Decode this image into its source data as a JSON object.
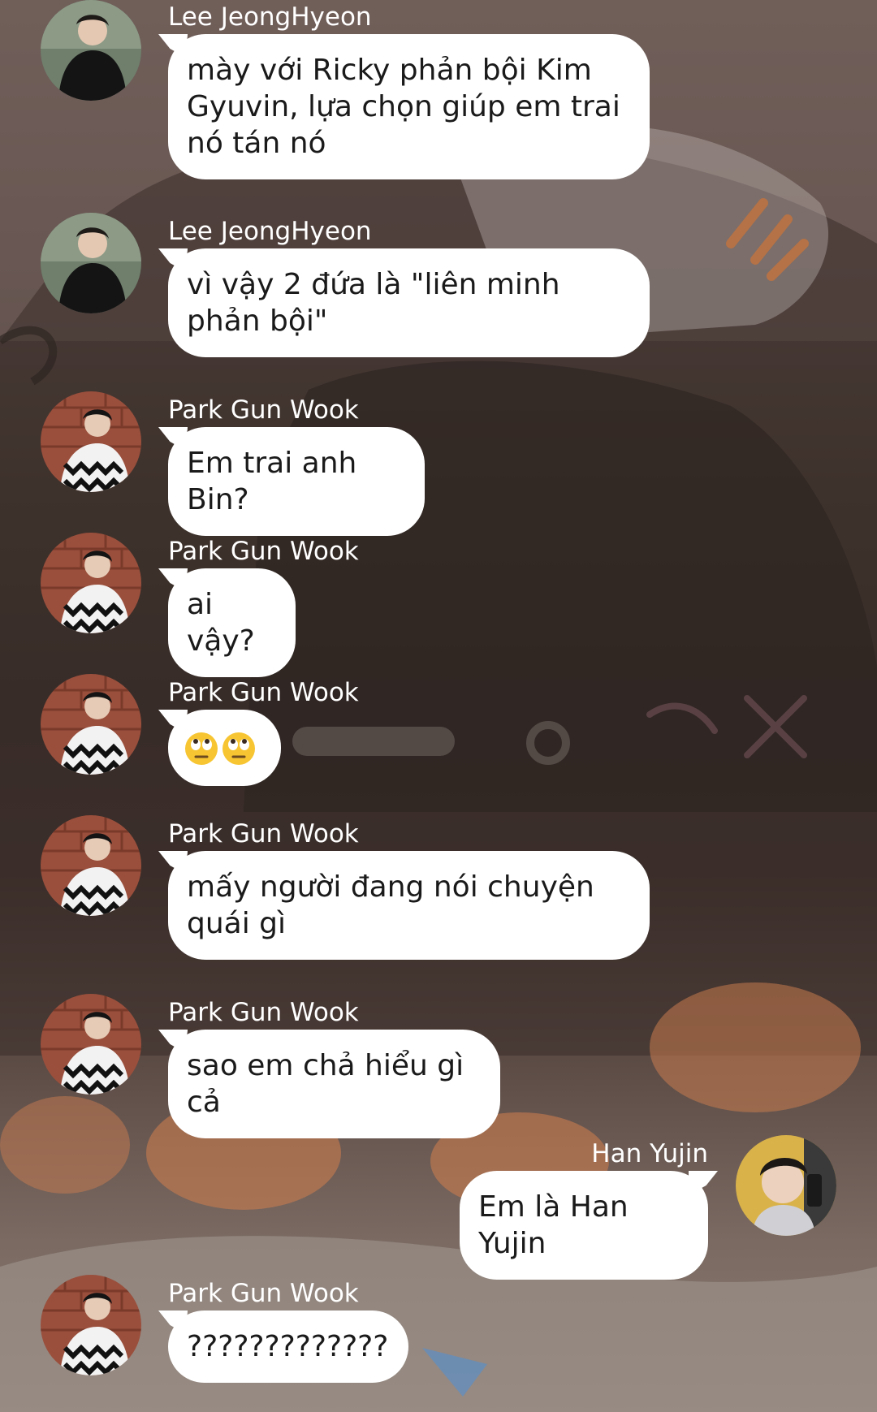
{
  "chat": {
    "messages": [
      {
        "sender": "Lee JeongHyeon",
        "text": "mày với Ricky phản bội Kim Gyuvin, lựa chọn giúp em trai nó tán nó",
        "direction": "incoming",
        "avatar": "avatar-lee-jeonghyeon"
      },
      {
        "sender": "Lee JeongHyeon",
        "text": "vì vậy 2 đứa là \"liên minh phản bội\"",
        "direction": "incoming",
        "avatar": "avatar-lee-jeonghyeon"
      },
      {
        "sender": "Park Gun Wook",
        "text": "Em trai anh Bin?",
        "direction": "incoming",
        "avatar": "avatar-park-gun-wook"
      },
      {
        "sender": "Park Gun Wook",
        "text": "ai vậy?",
        "direction": "incoming",
        "avatar": "avatar-park-gun-wook"
      },
      {
        "sender": "Park Gun Wook",
        "text": "",
        "emojis": [
          "eye-roll-emoji",
          "eye-roll-emoji"
        ],
        "direction": "incoming",
        "avatar": "avatar-park-gun-wook"
      },
      {
        "sender": "Park Gun Wook",
        "text": "mấy người đang nói chuyện quái gì",
        "direction": "incoming",
        "avatar": "avatar-park-gun-wook"
      },
      {
        "sender": "Park Gun Wook",
        "text": "sao em chả hiểu gì cả",
        "direction": "incoming",
        "avatar": "avatar-park-gun-wook"
      },
      {
        "sender": "Han Yujin",
        "text": "Em là Han Yujin",
        "direction": "outgoing",
        "avatar": "avatar-han-yujin"
      },
      {
        "sender": "Park Gun Wook",
        "text": "?????????????",
        "direction": "incoming",
        "avatar": "avatar-park-gun-wook"
      }
    ]
  },
  "colors": {
    "bubble": "#ffffff",
    "sender_text": "#ffffff",
    "message_text": "#1a1a1a",
    "background_dark": "#362b27"
  }
}
